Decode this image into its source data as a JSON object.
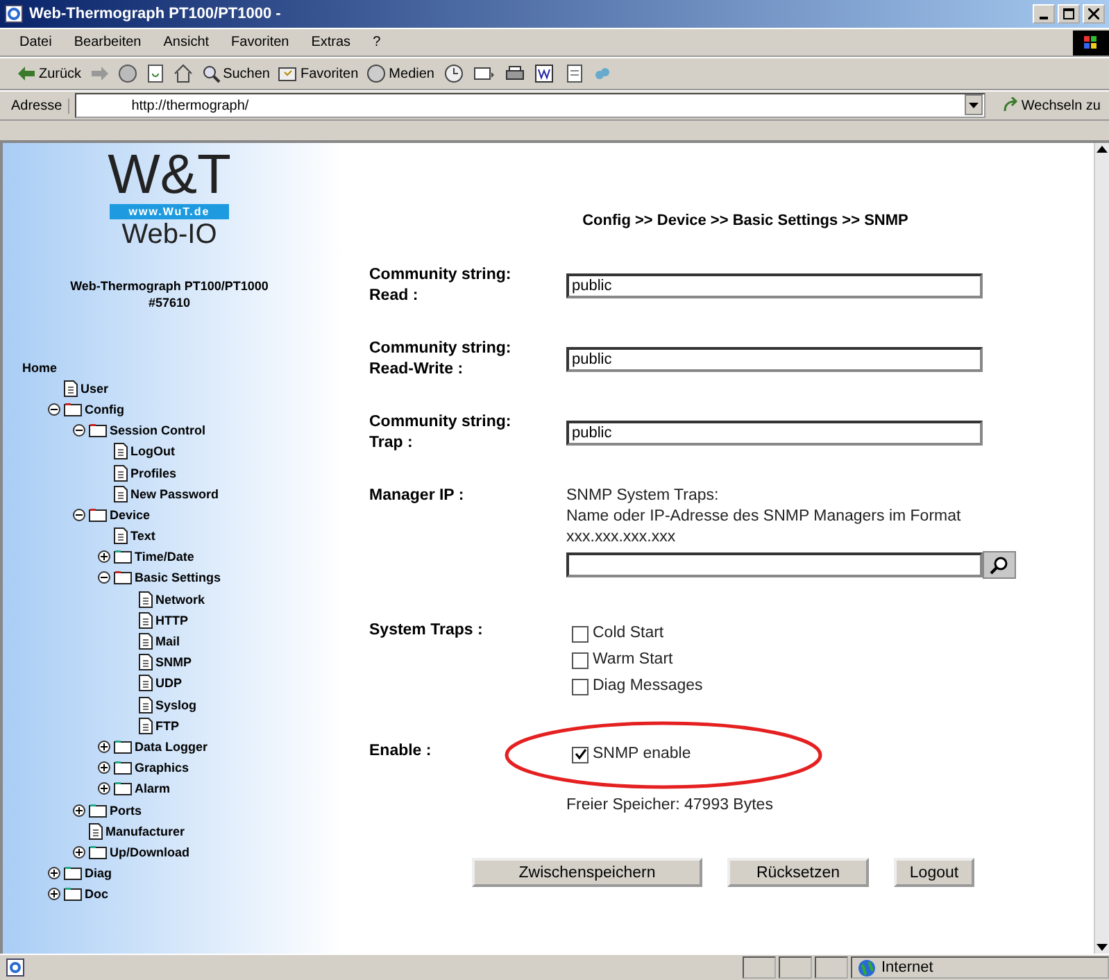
{
  "window": {
    "title": "Web-Thermograph PT100/PT1000 -"
  },
  "menu": [
    "Datei",
    "Bearbeiten",
    "Ansicht",
    "Favoriten",
    "Extras",
    "?"
  ],
  "toolbar": [
    {
      "kind": "back",
      "label": "Zurück"
    },
    {
      "kind": "forward"
    },
    {
      "kind": "stop"
    },
    {
      "kind": "refresh"
    },
    {
      "kind": "home"
    },
    {
      "kind": "search",
      "label": "Suchen"
    },
    {
      "kind": "favorites",
      "label": "Favoriten"
    },
    {
      "kind": "media",
      "label": "Medien"
    },
    {
      "kind": "history"
    },
    {
      "kind": "mail"
    },
    {
      "kind": "print"
    },
    {
      "kind": "edit"
    },
    {
      "kind": "discuss"
    },
    {
      "kind": "messenger"
    }
  ],
  "address": {
    "label": "Adresse",
    "value": "http://thermograph/",
    "go": "Wechseln zu"
  },
  "sidebar": {
    "logo": "W&T",
    "logo_url": "www.WuT.de",
    "logo_sub": "Web-IO",
    "device": "Web-Thermograph PT100/PT1000",
    "device_id": "#57610",
    "tree": [
      {
        "label": "Home",
        "kind": "root",
        "children": [
          {
            "label": "User",
            "kind": "page"
          },
          {
            "label": "Config",
            "kind": "folder",
            "expanded": true,
            "children": [
              {
                "label": "Session Control",
                "kind": "folder",
                "expanded": true,
                "children": [
                  {
                    "label": "LogOut",
                    "kind": "page"
                  },
                  {
                    "label": "Profiles",
                    "kind": "page"
                  },
                  {
                    "label": "New Password",
                    "kind": "page"
                  }
                ]
              },
              {
                "label": "Device",
                "kind": "folder",
                "expanded": true,
                "children": [
                  {
                    "label": "Text",
                    "kind": "page"
                  },
                  {
                    "label": "Time/Date",
                    "kind": "folder",
                    "expanded": false
                  },
                  {
                    "label": "Basic Settings",
                    "kind": "folder",
                    "expanded": true,
                    "children": [
                      {
                        "label": "Network",
                        "kind": "page"
                      },
                      {
                        "label": "HTTP",
                        "kind": "page"
                      },
                      {
                        "label": "Mail",
                        "kind": "page"
                      },
                      {
                        "label": "SNMP",
                        "kind": "page"
                      },
                      {
                        "label": "UDP",
                        "kind": "page"
                      },
                      {
                        "label": "Syslog",
                        "kind": "page"
                      },
                      {
                        "label": "FTP",
                        "kind": "page"
                      }
                    ]
                  },
                  {
                    "label": "Data Logger",
                    "kind": "folder",
                    "expanded": false
                  },
                  {
                    "label": "Graphics",
                    "kind": "folder",
                    "expanded": false
                  },
                  {
                    "label": "Alarm",
                    "kind": "folder",
                    "expanded": false
                  }
                ]
              },
              {
                "label": "Ports",
                "kind": "folder",
                "expanded": false
              },
              {
                "label": "Manufacturer",
                "kind": "page"
              },
              {
                "label": "Up/Download",
                "kind": "folder",
                "expanded": false
              }
            ]
          },
          {
            "label": "Diag",
            "kind": "folder",
            "expanded": false
          },
          {
            "label": "Doc",
            "kind": "folder",
            "expanded": false
          }
        ]
      }
    ]
  },
  "breadcrumb": "Config >> Device >> Basic Settings >> SNMP",
  "fields": [
    {
      "label": "Community string: Read :",
      "value": "public"
    },
    {
      "label": "Community string: Read-Write :",
      "value": "public"
    },
    {
      "label": "Community string: Trap :",
      "value": "public"
    }
  ],
  "manager": {
    "label": "Manager IP :",
    "title": "SNMP System Traps:",
    "hint": "Name oder IP-Adresse des SNMP Managers im Format xxx.xxx.xxx.xxx"
  },
  "system_traps": {
    "label": "System Traps :",
    "options": [
      {
        "label": "Cold Start",
        "checked": false
      },
      {
        "label": "Warm Start",
        "checked": false
      },
      {
        "label": "Diag Messages",
        "checked": false
      }
    ]
  },
  "enable": {
    "label": "Enable :",
    "option": {
      "label": "SNMP enable",
      "checked": true,
      "highlighted": true
    }
  },
  "free_memory": "Freier Speicher: 47993 Bytes",
  "buttons": [
    "Zwischenspeichern",
    "Rücksetzen",
    "Logout"
  ],
  "status_bar": {
    "zone": "Internet"
  }
}
